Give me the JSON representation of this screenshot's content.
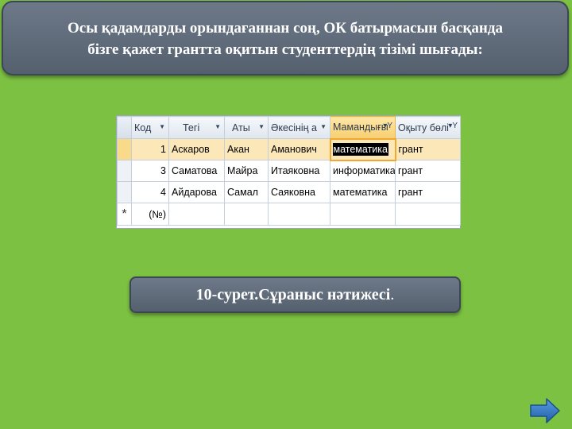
{
  "header": {
    "line1": "Осы қадамдарды орындағаннан соң, ОК батырмасын басқанда",
    "line2": "бізге қажет грантта оқитын студенттердің тізімі шығады:"
  },
  "table": {
    "columns": [
      "Код",
      "Тегі",
      "Аты",
      "Әкесінің а",
      "Мамандығы",
      "Оқыту бөлі"
    ],
    "rows": [
      {
        "kod": "1",
        "tegi": "Аскаров",
        "aty": "Акан",
        "akesi": "Аманович",
        "mamandygy": "математика",
        "oqytu": "грант"
      },
      {
        "kod": "3",
        "tegi": "Саматова",
        "aty": "Майра",
        "akesi": "Итаяковна",
        "mamandygy": "информатика",
        "oqytu": "грант"
      },
      {
        "kod": "4",
        "tegi": "Айдарова",
        "aty": "Самал",
        "akesi": "Саяковна",
        "mamandygy": "математика",
        "oqytu": "грант"
      }
    ],
    "new_row_marker": "*",
    "new_row_placeholder": "(№)"
  },
  "caption": {
    "text": "10-сурет.Сұраныс нәтижесі",
    "period": "."
  },
  "icons": {
    "next": "next-arrow-icon"
  },
  "colors": {
    "background": "#7cc142",
    "box": "#5f6b7a",
    "next_button": "#2e74c2"
  }
}
